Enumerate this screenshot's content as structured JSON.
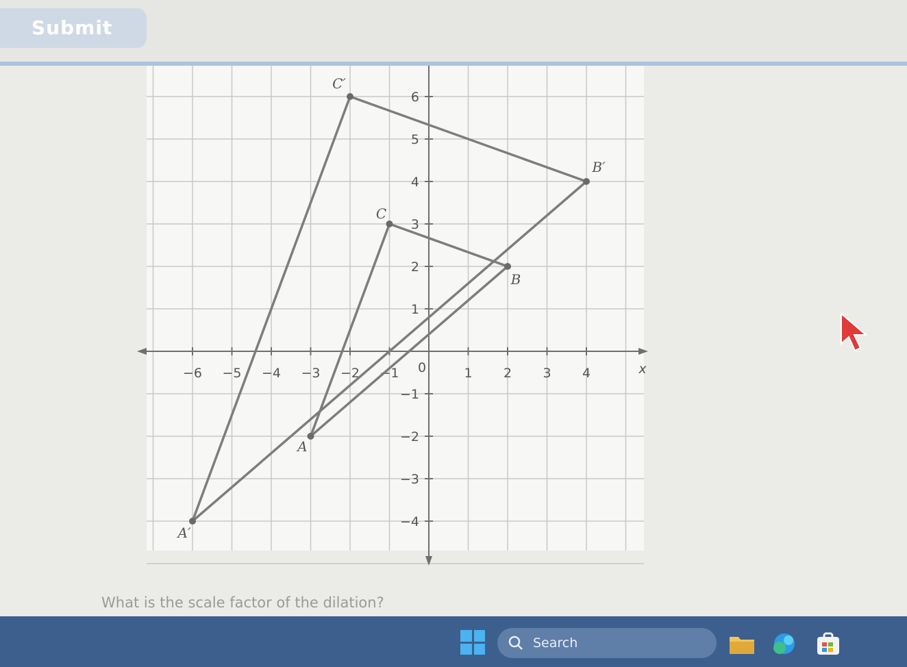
{
  "submit_button": {
    "label": "Submit"
  },
  "graph": {
    "x_axis_label": "x",
    "x_ticks": [
      -6,
      -5,
      -4,
      -3,
      -2,
      -1,
      1,
      2,
      3,
      4
    ],
    "y_ticks": [
      -4,
      -3,
      -2,
      -1,
      1,
      2,
      3,
      4,
      5,
      6
    ],
    "origin_label": "0",
    "triangle_original": [
      {
        "label": "A",
        "x": -3,
        "y": -2
      },
      {
        "label": "B",
        "x": 2,
        "y": 2
      },
      {
        "label": "C",
        "x": -1,
        "y": 3
      }
    ],
    "triangle_image": [
      {
        "label": "A′",
        "x": -6,
        "y": -4
      },
      {
        "label": "B′",
        "x": 4,
        "y": 4
      },
      {
        "label": "C′",
        "x": -2,
        "y": 6
      }
    ]
  },
  "question": {
    "text": "What is the scale factor of the dilation?"
  },
  "taskbar": {
    "search_label": "Search",
    "apps": [
      "file-explorer-icon",
      "copilot-icon",
      "store-icon"
    ]
  },
  "colors": {
    "grid": "#c8c8c6",
    "shape": "#7d7d7d",
    "taskbar": "#3c5f8e",
    "accent": "#4ab3f0"
  }
}
